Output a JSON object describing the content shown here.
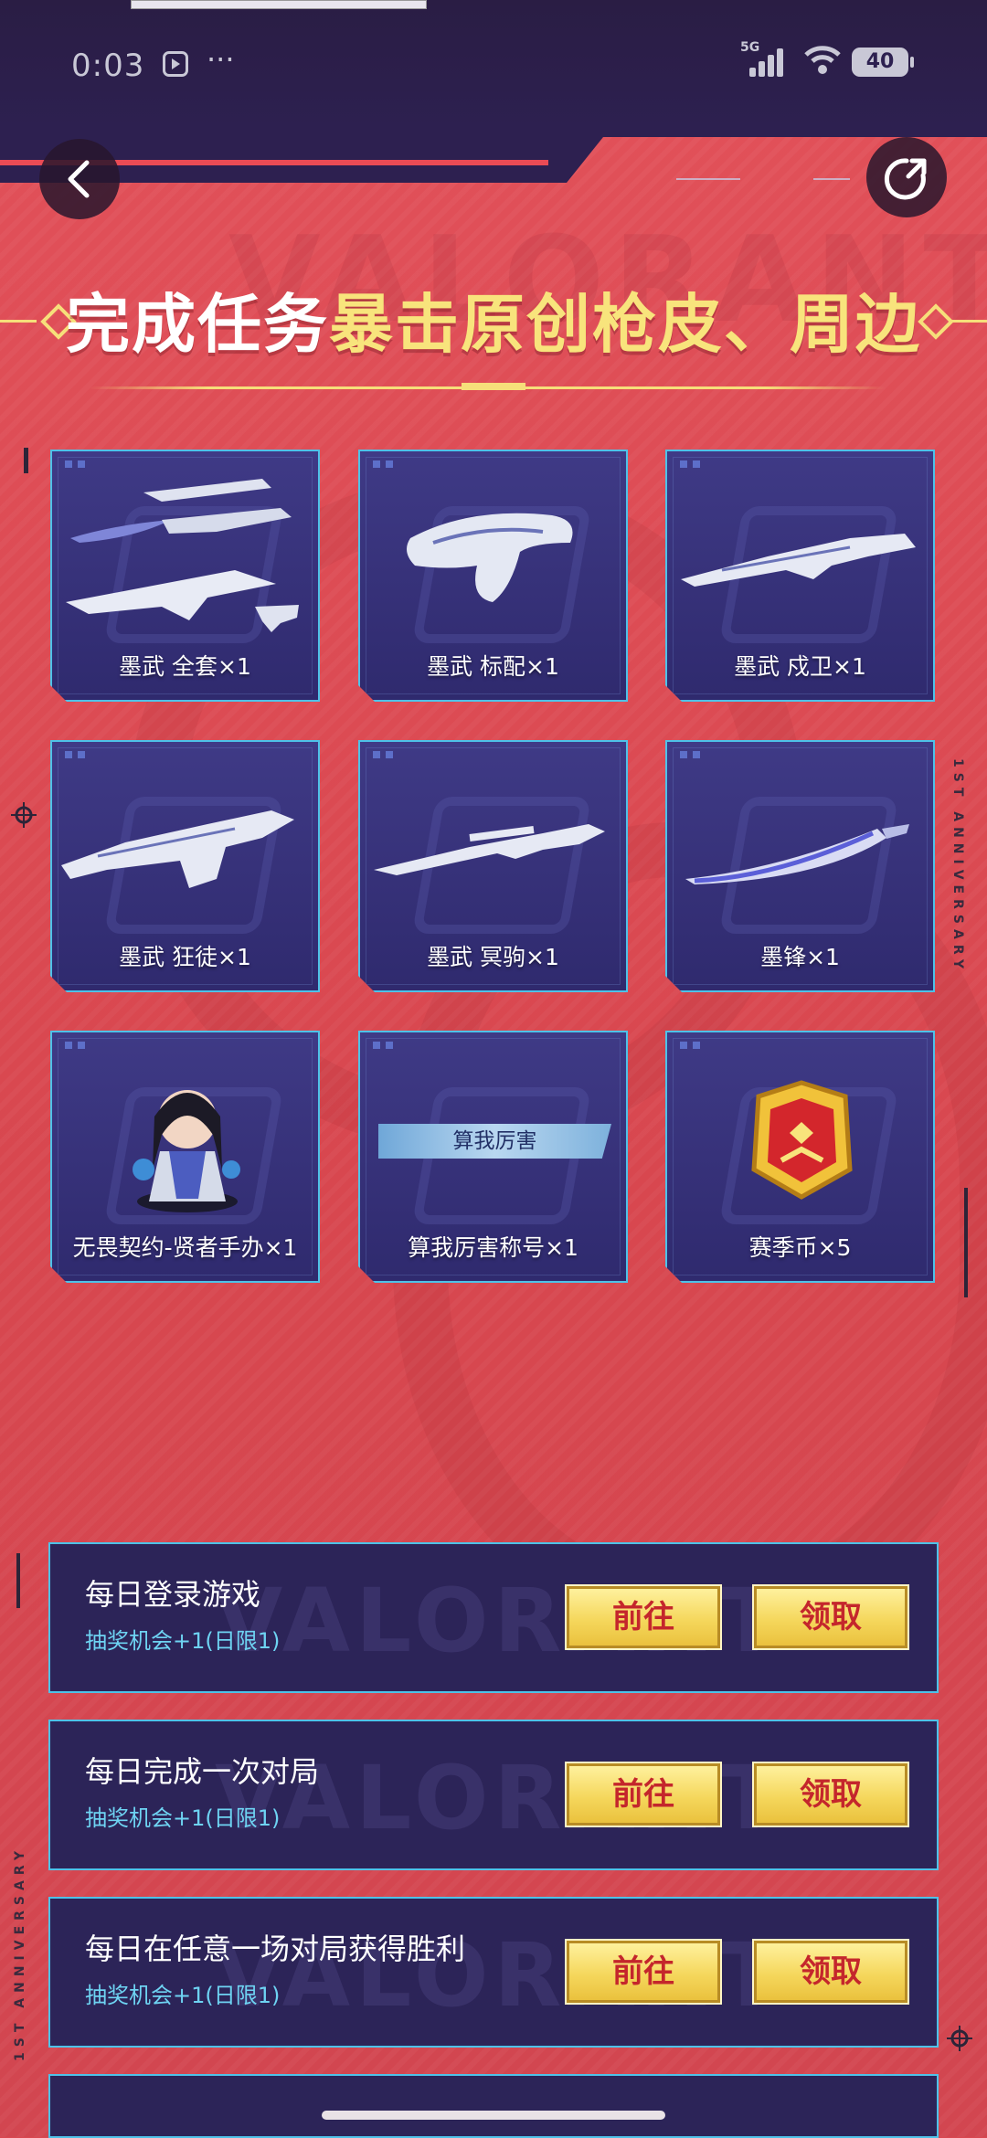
{
  "status_bar": {
    "time": "0:03",
    "network": "5G",
    "battery": "40"
  },
  "header": {
    "title_part1": "完成任务",
    "title_part2": "暴击原创枪皮、周边",
    "side_text": "1ST ANNIVERSARY",
    "watermark": "VALORANT"
  },
  "prizes": [
    {
      "label": "墨武 全套×1",
      "art": "weapon-set"
    },
    {
      "label": "墨武 标配×1",
      "art": "pistol"
    },
    {
      "label": "墨武 戍卫×1",
      "art": "rifle"
    },
    {
      "label": "墨武 狂徒×1",
      "art": "rifle"
    },
    {
      "label": "墨武 冥驹×1",
      "art": "sniper"
    },
    {
      "label": "墨锋×1",
      "art": "blade"
    },
    {
      "label": "无畏契约-贤者手办×1",
      "art": "figure"
    },
    {
      "label": "算我厉害称号×1",
      "art": "title-banner",
      "banner_text": "算我厉害"
    },
    {
      "label": "赛季币×5",
      "art": "coin"
    }
  ],
  "tasks": [
    {
      "title": "每日登录游戏",
      "reward": "抽奖机会+1(日限1)",
      "go_label": "前往",
      "claim_label": "领取"
    },
    {
      "title": "每日完成一次对局",
      "reward": "抽奖机会+1(日限1)",
      "go_label": "前往",
      "claim_label": "领取"
    },
    {
      "title": "每日在任意一场对局获得胜利",
      "reward": "抽奖机会+1(日限1)",
      "go_label": "前往",
      "claim_label": "领取"
    }
  ],
  "colors": {
    "background": "#d9474f",
    "card": "#332e77",
    "card_border": "#4ec2e8",
    "highlight": "#f8e47c",
    "button_text": "#c4262c"
  },
  "icons": {
    "back": "chevron-left-icon",
    "share": "share-icon"
  }
}
